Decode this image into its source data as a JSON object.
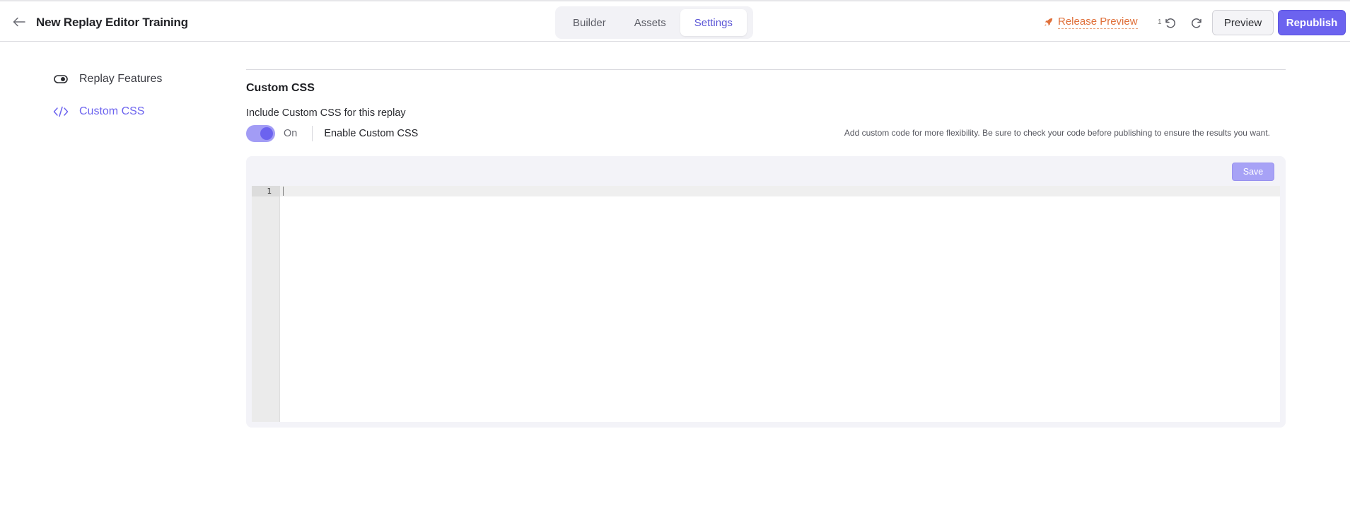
{
  "header": {
    "title": "New Replay Editor Training",
    "tabs": [
      {
        "label": "Builder",
        "active": false
      },
      {
        "label": "Assets",
        "active": false
      },
      {
        "label": "Settings",
        "active": true
      }
    ],
    "release_preview_label": "Release Preview",
    "undo_count": "1",
    "preview_label": "Preview",
    "republish_label": "Republish"
  },
  "sidebar": {
    "items": [
      {
        "label": "Replay Features",
        "icon": "toggle-icon",
        "active": false
      },
      {
        "label": "Custom CSS",
        "icon": "code-icon",
        "active": true
      }
    ]
  },
  "main": {
    "section_title": "Custom CSS",
    "include_label": "Include Custom CSS for this replay",
    "toggle_state": "On",
    "toggle_on": true,
    "enable_label": "Enable Custom CSS",
    "helper_text": "Add custom code for more flexibility. Be sure to check your code before publishing to ensure the results you want.",
    "save_label": "Save",
    "editor": {
      "line_numbers": [
        "1"
      ],
      "content": ""
    }
  },
  "colors": {
    "accent": "#6c63ef",
    "accent_light": "#a7a2f6",
    "release_orange": "#e0703a"
  }
}
